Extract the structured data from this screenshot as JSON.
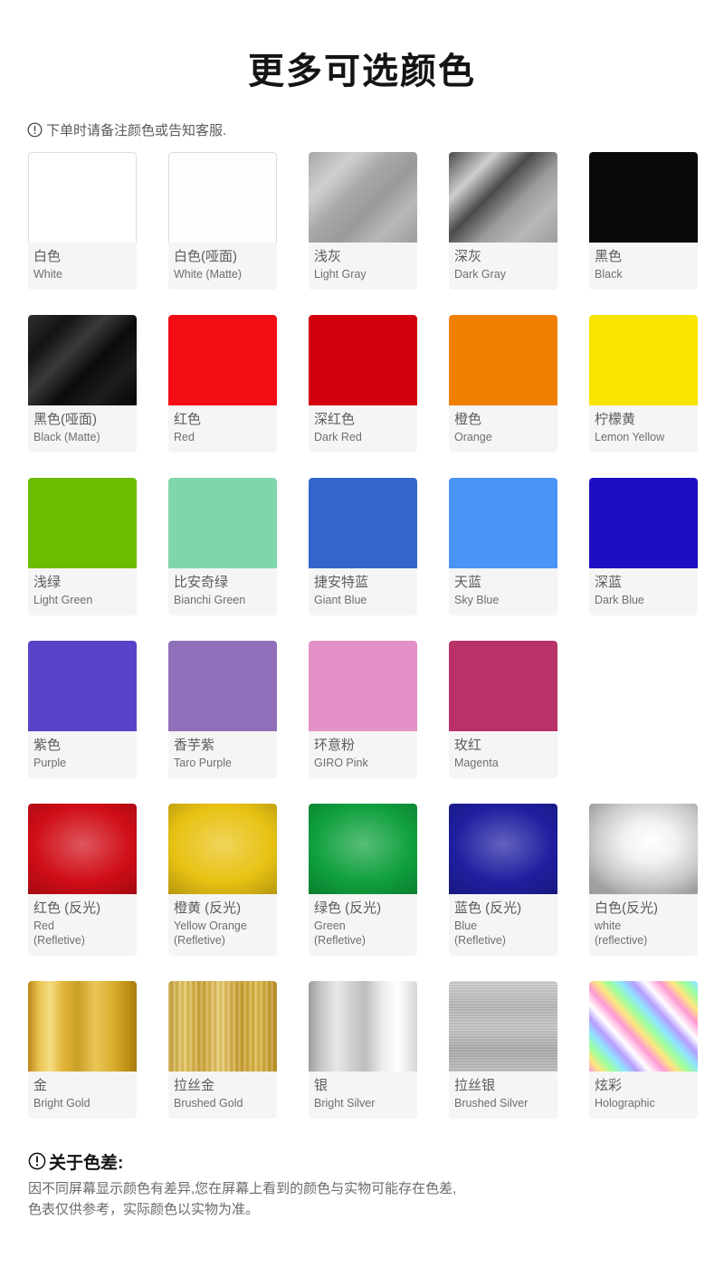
{
  "header": {
    "title": "更多可选颜色",
    "notice_icon": "exclamation-circle-icon",
    "notice": "下单时请备注颜色或告知客服."
  },
  "footer": {
    "icon": "exclamation-circle-icon",
    "heading": "关于色差:",
    "body": "因不同屏幕显示颜色有差异,您在屏幕上看到的颜色与实物可能存在色差,\n色表仅供参考，实际颜色以实物为准。"
  },
  "colors": [
    [
      {
        "cn": "白色",
        "en": "White",
        "hex": "#ffffff",
        "style": "flat-bordered"
      },
      {
        "cn": "白色(哑面)",
        "en": "White (Matte)",
        "hex": "#fefefe",
        "style": "flat-bordered"
      },
      {
        "cn": "浅灰",
        "en": "Light Gray",
        "hex": "#a8a8a8",
        "style": "gloss-diagonal"
      },
      {
        "cn": "深灰",
        "en": "Dark Gray",
        "hex": "#4a4a4a",
        "style": "gloss-diagonal"
      },
      {
        "cn": "黑色",
        "en": "Black",
        "hex": "#0a0a0a",
        "style": "flat"
      }
    ],
    [
      {
        "cn": "黑色(哑面)",
        "en": "Black (Matte)",
        "hex": "#101010",
        "style": "matte-diagonal"
      },
      {
        "cn": "红色",
        "en": "Red",
        "hex": "#f20d14",
        "style": "flat"
      },
      {
        "cn": "深红色",
        "en": "Dark Red",
        "hex": "#d2000f",
        "style": "flat"
      },
      {
        "cn": "橙色",
        "en": "Orange",
        "hex": "#f08000",
        "style": "flat"
      },
      {
        "cn": "柠檬黄",
        "en": "Lemon Yellow",
        "hex": "#f7e500",
        "style": "flat"
      }
    ],
    [
      {
        "cn": "浅绿",
        "en": "Light Green",
        "hex": "#6cbd02",
        "style": "flat"
      },
      {
        "cn": "比安奇绿",
        "en": "Bianchi Green",
        "hex": "#7fd6ab",
        "style": "flat"
      },
      {
        "cn": "捷安特蓝",
        "en": "Giant Blue",
        "hex": "#3366cc",
        "style": "flat"
      },
      {
        "cn": "天蓝",
        "en": "Sky Blue",
        "hex": "#4a94f7",
        "style": "flat"
      },
      {
        "cn": "深蓝",
        "en": "Dark Blue",
        "hex": "#1f0dc4",
        "style": "flat"
      }
    ],
    [
      {
        "cn": "紫色",
        "en": "Purple",
        "hex": "#5a42c8",
        "style": "flat"
      },
      {
        "cn": "香芋紫",
        "en": "Taro Purple",
        "hex": "#9070bb",
        "style": "flat"
      },
      {
        "cn": "环意粉",
        "en": "GIRO Pink",
        "hex": "#e391c8",
        "style": "flat"
      },
      {
        "cn": "玫红",
        "en": "Magenta",
        "hex": "#b83268",
        "style": "flat"
      },
      {
        "cn": "",
        "en": "",
        "hex": "",
        "style": "empty"
      }
    ],
    [
      {
        "cn": "红色 (反光)",
        "en": "Red\n(Refletive)",
        "hex": "#d00d17",
        "style": "reflective"
      },
      {
        "cn": "橙黄 (反光)",
        "en": "Yellow Orange\n(Refletive)",
        "hex": "#e8c213",
        "style": "reflective"
      },
      {
        "cn": "绿色 (反光)",
        "en": "Green\n(Refletive)",
        "hex": "#10a03e",
        "style": "reflective"
      },
      {
        "cn": "蓝色 (反光)",
        "en": "Blue\n(Refletive)",
        "hex": "#1f1fa0",
        "style": "reflective"
      },
      {
        "cn": "白色(反光)",
        "en": "white\n(reflective)",
        "hex": "#c9c9c9",
        "style": "reflective-white"
      }
    ],
    [
      {
        "cn": "金",
        "en": "Bright Gold",
        "hex": "#d8a422",
        "style": "gold-bright"
      },
      {
        "cn": "拉丝金",
        "en": "Brushed Gold",
        "hex": "#cfa52e",
        "style": "gold-brushed"
      },
      {
        "cn": "银",
        "en": "Bright Silver",
        "hex": "#c4c4c4",
        "style": "silver-bright"
      },
      {
        "cn": "拉丝银",
        "en": "Brushed Silver",
        "hex": "#b0b0b0",
        "style": "silver-brushed"
      },
      {
        "cn": "炫彩",
        "en": "Holographic",
        "hex": "#cfc4e8",
        "style": "holographic"
      }
    ]
  ]
}
